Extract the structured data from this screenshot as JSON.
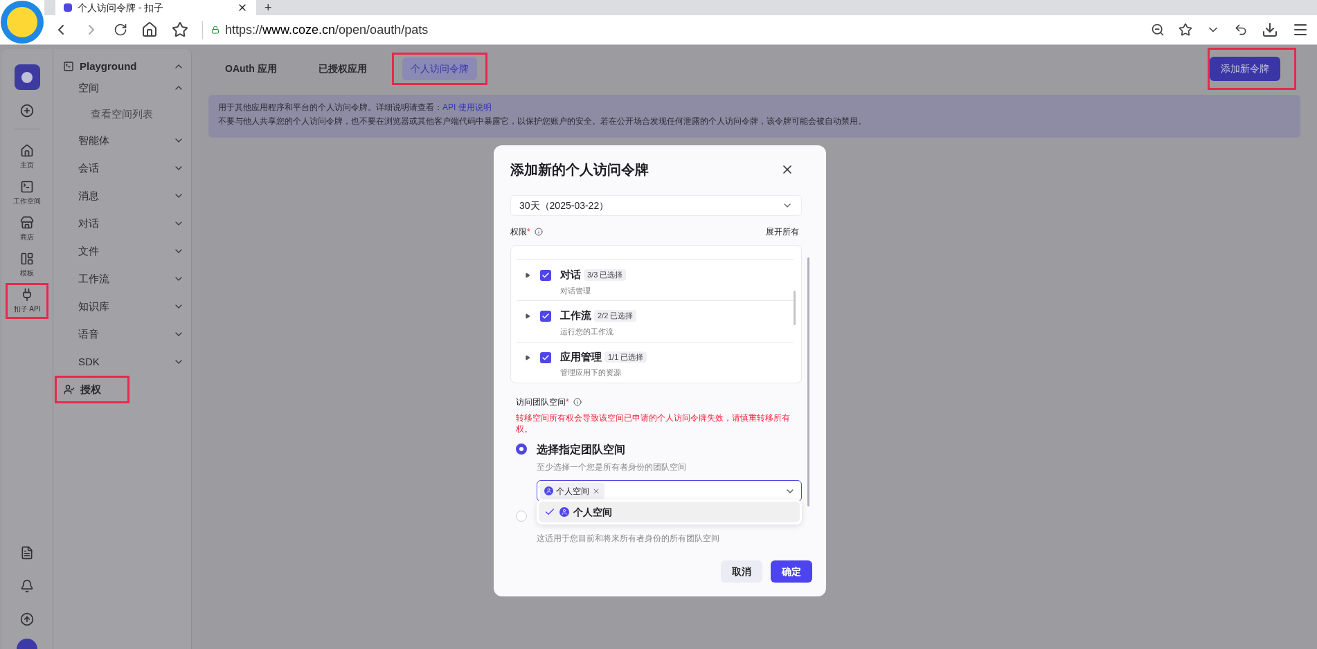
{
  "browser": {
    "tab_title": "个人访问令牌 - 扣子",
    "url_host": "www.coze.cn",
    "url_scheme": "https://",
    "url_path": "/open/oauth/pats",
    "new_tab": "+"
  },
  "rail": {
    "items": [
      {
        "kind": "home",
        "label": "主页",
        "annotated": false
      },
      {
        "kind": "workspace",
        "label": "工作空间",
        "annotated": false
      },
      {
        "kind": "store",
        "label": "商店",
        "annotated": false
      },
      {
        "kind": "template",
        "label": "模板",
        "annotated": false
      },
      {
        "kind": "api",
        "label": "扣子 API",
        "annotated": true
      }
    ]
  },
  "nav": {
    "title": "Playground",
    "expanded": true,
    "items": [
      {
        "label": "空间",
        "expanded": true,
        "children": [
          {
            "label": "查看空间列表"
          }
        ]
      },
      {
        "label": "智能体",
        "expanded": false
      },
      {
        "label": "会话",
        "expanded": false
      },
      {
        "label": "消息",
        "expanded": false
      },
      {
        "label": "对话",
        "expanded": false
      },
      {
        "label": "文件",
        "expanded": false
      },
      {
        "label": "工作流",
        "expanded": false
      },
      {
        "label": "知识库",
        "expanded": false
      },
      {
        "label": "语音",
        "expanded": false
      },
      {
        "label": "SDK",
        "expanded": false
      }
    ],
    "auth": {
      "label": "授权",
      "annotated": true
    }
  },
  "tabs": [
    {
      "label": "OAuth 应用",
      "selected": false,
      "annotated": false
    },
    {
      "label": "已授权应用",
      "selected": false,
      "annotated": false
    },
    {
      "label": "个人访问令牌",
      "selected": true,
      "annotated": true
    }
  ],
  "add_button": {
    "label": "添加新令牌",
    "annotated": true
  },
  "banner": {
    "line1": "用于其他应用程序和平台的个人访问令牌。详细说明请查看：",
    "link": "API 使用说明",
    "line2": "不要与他人共享您的个人访问令牌，也不要在浏览器或其他客户端代码中暴露它，以保护您账户的安全。若在公开场合发现任何泄露的个人访问令牌，该令牌可能会被自动禁用。"
  },
  "modal": {
    "title": "添加新的个人访问令牌",
    "expiry": "30天（2025-03-22）",
    "permissions_label": "权限",
    "required_mark": "*",
    "expand_all": "展开所有",
    "permissions": [
      {
        "name": "对话",
        "count": "3/3 已选择",
        "description": "对话管理",
        "checked": true
      },
      {
        "name": "工作流",
        "count": "2/2 已选择",
        "description": "运行您的工作流",
        "checked": true
      },
      {
        "name": "应用管理",
        "count": "1/1 已选择",
        "description": "管理应用下的资源",
        "checked": true
      }
    ],
    "team_label": "访问团队空间",
    "warning": "转移空间所有权会导致该空间已申请的个人访问令牌失效，请慎重转移所有权。",
    "options": [
      {
        "label": "选择指定团队空间",
        "description": "至少选择一个您是所有者身份的团队空间",
        "selected": true
      },
      {
        "description": "这适用于您目前和将来所有者身份的所有团队空间",
        "selected": false
      }
    ],
    "tags": [
      "个人空间"
    ],
    "dropdown": [
      {
        "label": "个人空间",
        "selected": true
      }
    ],
    "cancel": "取消",
    "confirm": "确定"
  }
}
